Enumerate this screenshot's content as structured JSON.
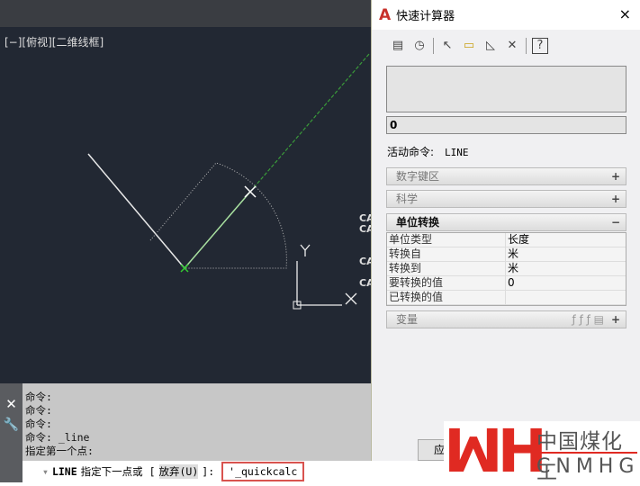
{
  "viewport": {
    "label": "[−][俯视][二维线框]",
    "side_labels": [
      "CA",
      "CA",
      "CA",
      "CA"
    ],
    "axis_x": "X",
    "axis_y": "Y"
  },
  "command": {
    "history": [
      "命令:",
      "命令:",
      "命令:",
      "命令: _line",
      "指定第一个点:"
    ],
    "prompt_cmd": "LINE",
    "prompt_text": "指定下一点或 [",
    "option": "放弃(U)",
    "prompt_end": "]:",
    "input": "'_quickcalc"
  },
  "dialog": {
    "title": "快速计算器",
    "close": "×",
    "result": "0",
    "active_label": "活动命令:",
    "active_value": "LINE",
    "sections": [
      {
        "label": "数字键区",
        "state": "+"
      },
      {
        "label": "科学",
        "state": "+"
      },
      {
        "label": "单位转换",
        "state": "−"
      },
      {
        "label": "变量",
        "state": "+"
      }
    ],
    "unit_rows": [
      {
        "k": "单位类型",
        "v": "长度"
      },
      {
        "k": "转换自",
        "v": "米"
      },
      {
        "k": "转换到",
        "v": "米"
      },
      {
        "k": "要转换的值",
        "v": "0"
      },
      {
        "k": "已转换的值",
        "v": ""
      }
    ],
    "apply": "应用"
  },
  "watermark": {
    "mark": "MH",
    "cn": "中国煤化工",
    "en": "CNMHG"
  }
}
